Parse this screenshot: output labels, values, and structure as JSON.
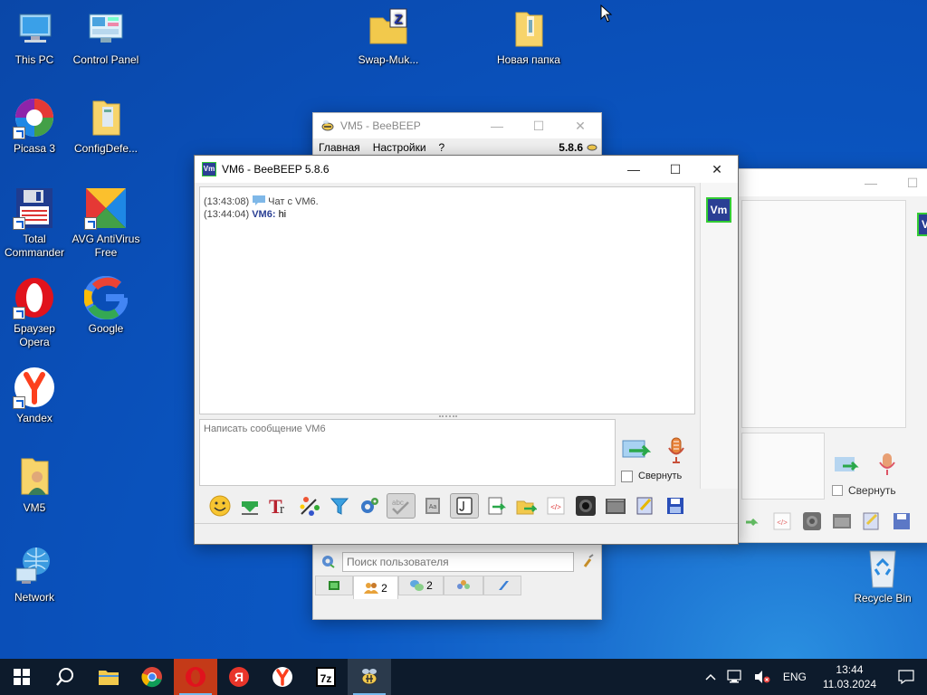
{
  "desktop": {
    "icons": [
      {
        "label": "This PC"
      },
      {
        "label": "Control Panel"
      },
      {
        "label": "Swap-Muk..."
      },
      {
        "label": "Новая папка"
      },
      {
        "label": "Picasa 3"
      },
      {
        "label": "ConfigDefe..."
      },
      {
        "label": "Total Commander"
      },
      {
        "label": "AVG AntiVirus Free"
      },
      {
        "label": "Браузер Opera"
      },
      {
        "label": "Google"
      },
      {
        "label": "Yandex"
      },
      {
        "label": "VM5"
      },
      {
        "label": "Network"
      },
      {
        "label": "Recycle Bin"
      }
    ]
  },
  "vm5_window": {
    "title": "VM5 - BeeBEEP",
    "menu": [
      "Главная",
      "Настройки",
      "?"
    ],
    "version": "5.8.6",
    "search_placeholder": "Поиск пользователя",
    "tabs": [
      {
        "count": ""
      },
      {
        "count": "2"
      },
      {
        "count": "2"
      },
      {
        "count": ""
      },
      {
        "count": ""
      }
    ]
  },
  "bg_window": {
    "collapse_label": "Свернуть",
    "avatar_text": "V"
  },
  "vm6_window": {
    "title": "VM6 - BeeBEEP 5.8.6",
    "messages": [
      {
        "time": "(13:43:08)",
        "sender": "",
        "text": "Чат с VM6."
      },
      {
        "time": "(13:44:04)",
        "sender": "VM6:",
        "text": "hi"
      }
    ],
    "input_placeholder": "Написать сообщение VM6",
    "collapse_label": "Свернуть",
    "avatar_text": "Vm"
  },
  "taskbar": {
    "lang": "ENG",
    "time": "13:44",
    "date": "11.03.2024",
    "seven_zip_label": "7z"
  }
}
